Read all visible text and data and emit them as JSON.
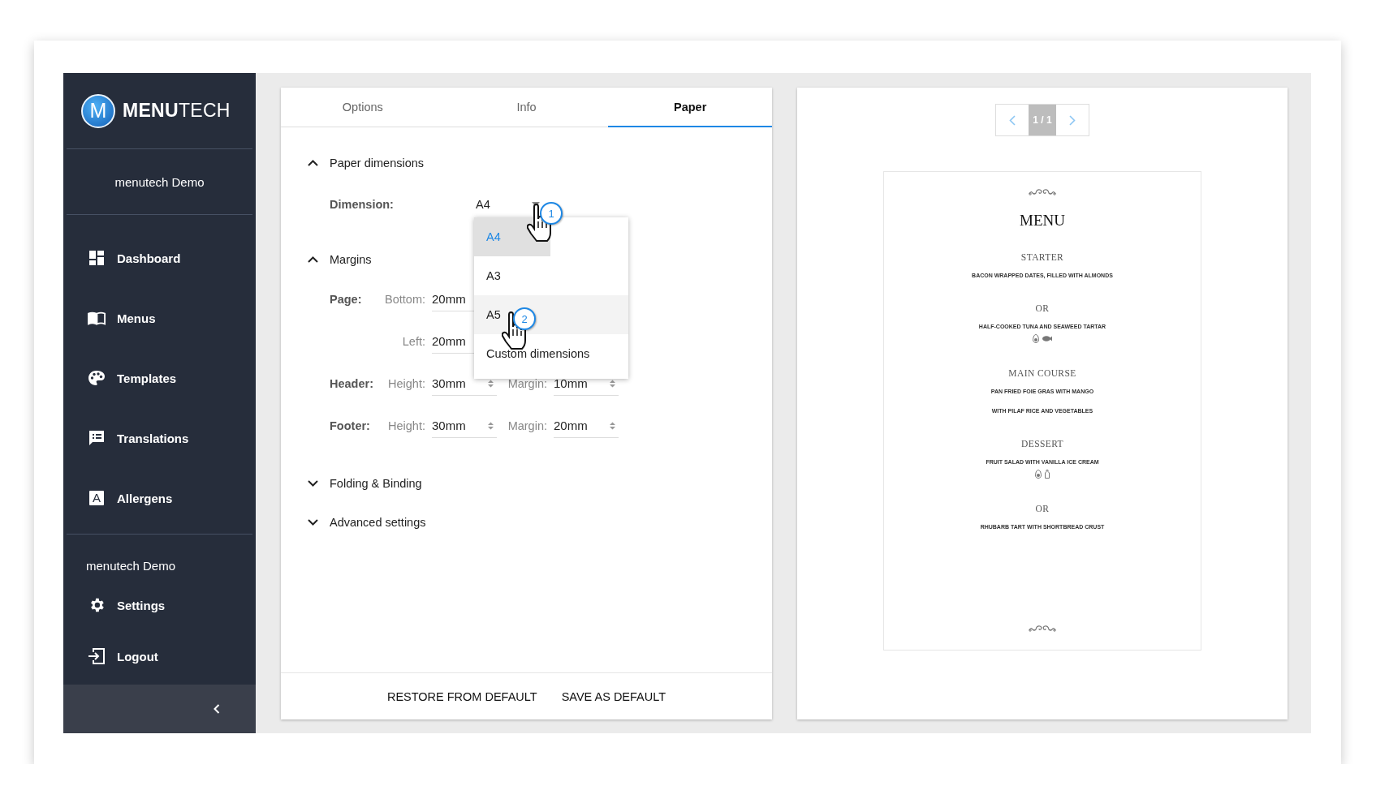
{
  "sidebar": {
    "logo_mark": "M",
    "brand": "**MENU**TECH",
    "account": "menutech Demo",
    "nav": [
      {
        "label": "Dashboard"
      },
      {
        "label": "Menus"
      },
      {
        "label": "Templates"
      },
      {
        "label": "Translations"
      },
      {
        "label": "Allergens",
        "icon_text": "A"
      }
    ],
    "footer_account": "menutech Demo",
    "footer_items": [
      {
        "label": "Settings"
      },
      {
        "label": "Logout"
      }
    ]
  },
  "tabs": [
    {
      "label": "Options",
      "selected": false
    },
    {
      "label": "Info",
      "selected": false
    },
    {
      "label": "Paper",
      "selected": true
    }
  ],
  "sections": [
    {
      "kind": "dimensions",
      "title": "Paper dimensions",
      "expanded": true,
      "field_label": "Dimension:",
      "value": "A4",
      "options": [
        {
          "label": "A4",
          "selected": true,
          "hovered": false
        },
        {
          "label": "A3",
          "selected": false,
          "hovered": false
        },
        {
          "label": "A5",
          "selected": false,
          "hovered": true
        },
        {
          "label": "Custom dimensions",
          "selected": false,
          "hovered": false
        }
      ]
    },
    {
      "kind": "margins",
      "title": "Margins",
      "expanded": true,
      "rows": [
        {
          "label": "Page:",
          "fields": [
            {
              "label": "Bottom:",
              "value": "20mm"
            }
          ]
        },
        {
          "fields": [
            {
              "label": "Left:",
              "value": "20mm"
            }
          ]
        },
        {
          "label": "Header:",
          "fields": [
            {
              "label": "Height:",
              "value": "30mm",
              "spinner": true
            },
            {
              "label": "Margin:",
              "value": "10mm",
              "spinner": true
            }
          ]
        },
        {
          "label": "Footer:",
          "fields": [
            {
              "label": "Height:",
              "value": "30mm",
              "spinner": true
            },
            {
              "label": "Margin:",
              "value": "20mm",
              "spinner": true
            }
          ]
        }
      ]
    },
    {
      "kind": "group",
      "title": "Folding & Binding",
      "expanded": false
    },
    {
      "kind": "group",
      "title": "Advanced settings",
      "expanded": false
    }
  ],
  "actions": [
    "RESTORE FROM DEFAULT",
    "SAVE AS DEFAULT"
  ],
  "annotations": [
    {
      "label": "1"
    },
    {
      "label": "2"
    }
  ],
  "preview": {
    "page": "1 / 1",
    "items": [
      {
        "kind": "ornament"
      },
      {
        "kind": "title",
        "text": "MENU"
      },
      {
        "kind": "heading",
        "text": "STARTER"
      },
      {
        "kind": "dish",
        "text": "BACON WRAPPED DATES, FILLED WITH ALMONDS"
      },
      {
        "kind": "heading",
        "text": "OR"
      },
      {
        "kind": "dish",
        "text": "HALF-COOKED TUNA AND SEAWEED TARTAR",
        "allergens": [
          {
            "kind": "egg"
          },
          {
            "kind": "fish"
          }
        ]
      },
      {
        "kind": "heading",
        "text": "MAIN COURSE"
      },
      {
        "kind": "dish",
        "text": "PAN FRIED FOIE GRAS WITH MANGO"
      },
      {
        "kind": "dish",
        "text": "WITH PILAF RICE AND VEGETABLES"
      },
      {
        "kind": "heading",
        "text": "DESSERT"
      },
      {
        "kind": "dish",
        "text": "FRUIT SALAD WITH VANILLA ICE CREAM",
        "allergens": [
          {
            "kind": "egg"
          },
          {
            "kind": "milk"
          }
        ]
      },
      {
        "kind": "heading",
        "text": "OR"
      },
      {
        "kind": "dish",
        "text": "RHUBARB TART WITH SHORTBREAD CRUST"
      },
      {
        "kind": "ornament"
      }
    ]
  }
}
